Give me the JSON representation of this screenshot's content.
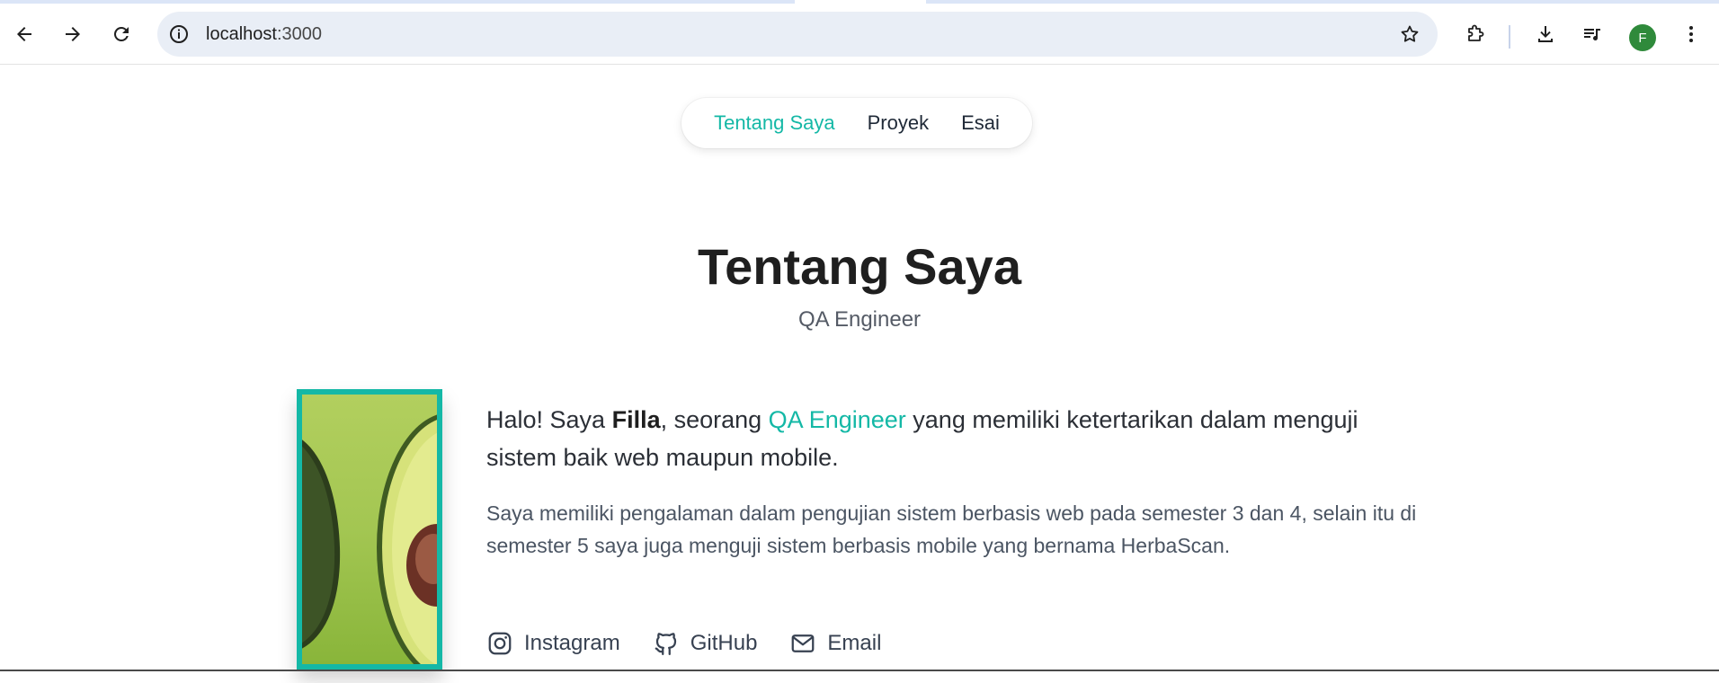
{
  "browser": {
    "url_host": "localhost",
    "url_port": ":3000",
    "profile_initial": "F",
    "icons": [
      "back-arrow-icon",
      "forward-arrow-icon",
      "reload-icon",
      "site-info-icon",
      "star-icon",
      "extensions-icon",
      "download-icon",
      "media-controls-icon",
      "more-vert-icon"
    ]
  },
  "nav": {
    "items": [
      {
        "label": "Tentang Saya",
        "active": true
      },
      {
        "label": "Proyek",
        "active": false
      },
      {
        "label": "Esai",
        "active": false
      }
    ]
  },
  "header": {
    "title": "Tentang Saya",
    "subtitle": "QA Engineer"
  },
  "about": {
    "intro_prefix": "Halo! Saya ",
    "name": "Filla",
    "intro_mid": ", seorang ",
    "role": "QA Engineer",
    "intro_suffix": " yang memiliki ketertarikan dalam menguji sistem baik web maupun mobile.",
    "detail": "Saya memiliki pengalaman dalam pengujian sistem berbasis web pada semester 3 dan 4, selain itu di semester 5 saya juga menguji sistem berbasis mobile yang bernama HerbaScan."
  },
  "socials": [
    {
      "label": "Instagram",
      "icon": "instagram-icon"
    },
    {
      "label": "GitHub",
      "icon": "github-icon"
    },
    {
      "label": "Email",
      "icon": "mail-icon"
    }
  ],
  "colors": {
    "accent": "#14b8a6",
    "omnibox": "#e9eef6",
    "avatar": "#2f8a3b"
  }
}
